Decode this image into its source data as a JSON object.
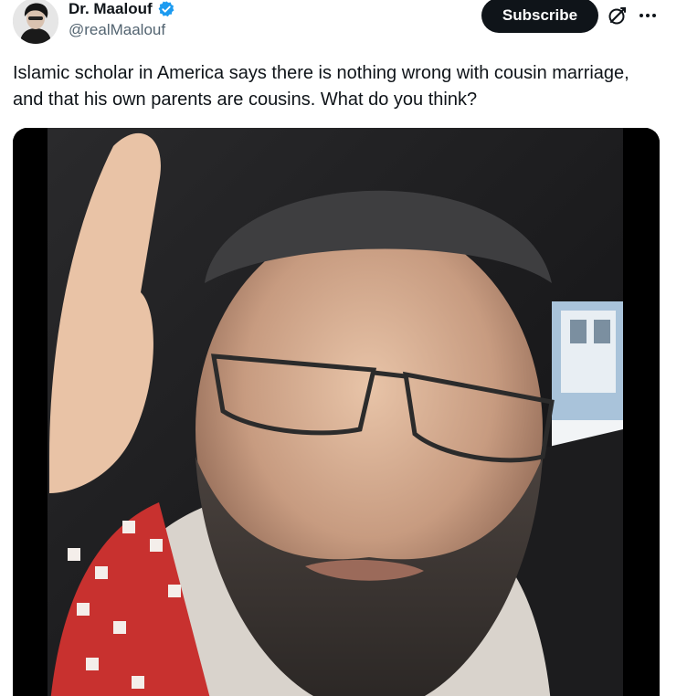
{
  "author": {
    "display_name": "Dr. Maalouf",
    "handle": "@realMaalouf",
    "verified": true
  },
  "actions": {
    "subscribe_label": "Subscribe"
  },
  "icons": {
    "verified": "verified-badge-icon",
    "grok": "grok-icon",
    "more": "more-options-icon"
  },
  "tweet": {
    "text": "Islamic scholar in America says there is nothing wrong with cousin marriage, and that his own parents are cousins. What do you think?"
  },
  "colors": {
    "subscribe_bg": "#0f1419",
    "verified_blue": "#1d9bf0",
    "handle_gray": "#536471"
  }
}
